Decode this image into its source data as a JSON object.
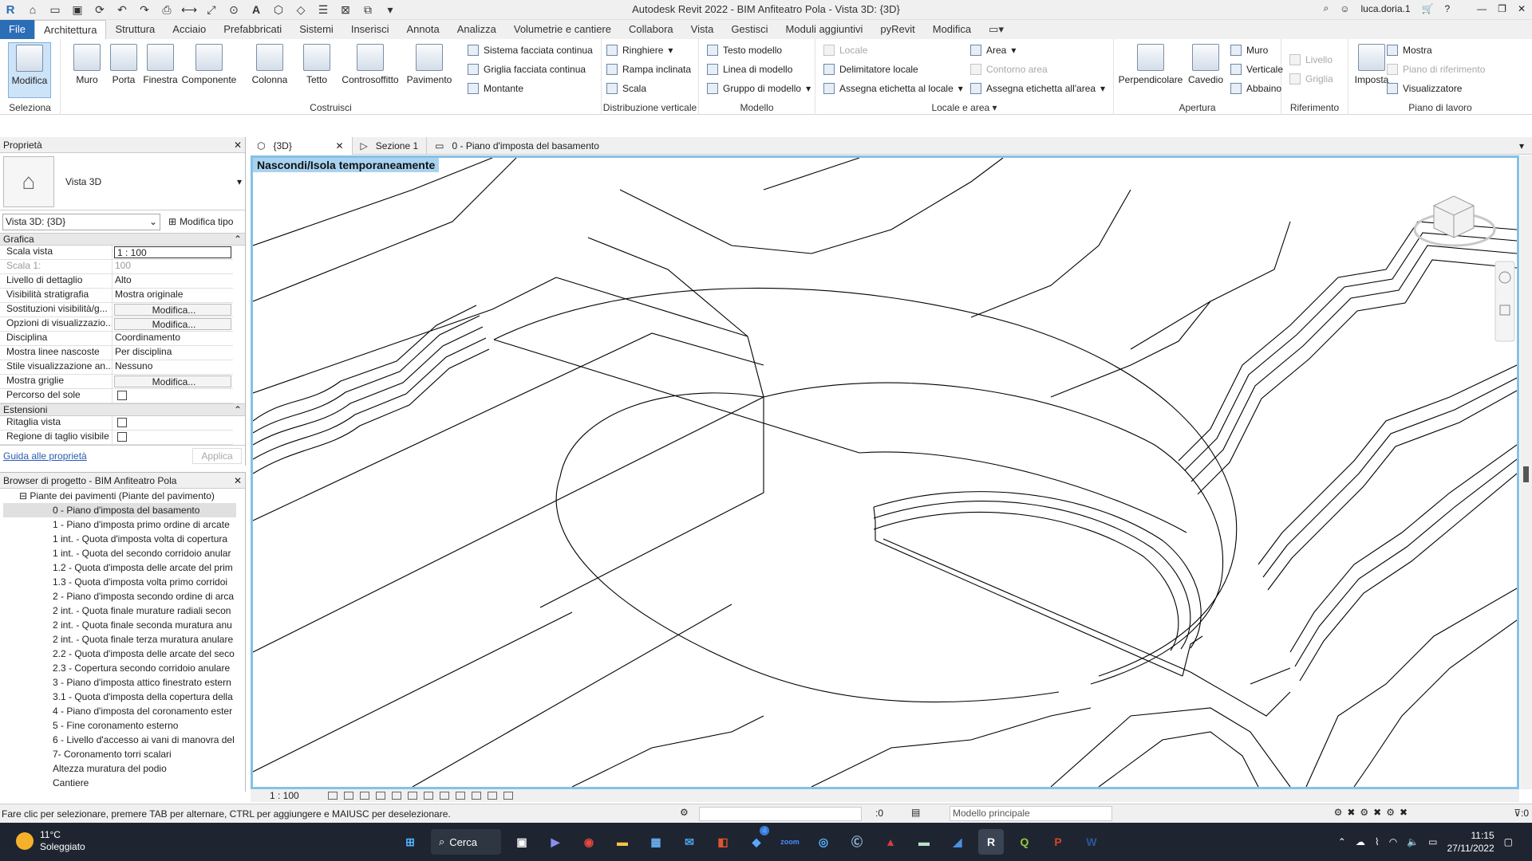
{
  "window": {
    "title": "Autodesk Revit 2022 - BIM Anfiteatro Pola - Vista 3D: {3D}",
    "user": "luca.doria.1"
  },
  "tabs": [
    "File",
    "Architettura",
    "Struttura",
    "Acciaio",
    "Prefabbricati",
    "Sistemi",
    "Inserisci",
    "Annota",
    "Analizza",
    "Volumetrie e cantiere",
    "Collabora",
    "Vista",
    "Gestisci",
    "Moduli aggiuntivi",
    "pyRevit",
    "Modifica"
  ],
  "ribbon": {
    "select": {
      "modify": "Modifica",
      "panel": "Seleziona"
    },
    "build": {
      "panel": "Costruisci",
      "items": [
        "Muro",
        "Porta",
        "Finestra",
        "Componente",
        "Colonna",
        "Tetto",
        "Controsoffitto",
        "Pavimento"
      ],
      "small": [
        "Sistema facciata continua",
        "Griglia facciata continua",
        "Montante"
      ]
    },
    "circulation": {
      "panel": "Distribuzione verticale",
      "items": [
        "Ringhiere",
        "Rampa inclinata",
        "Scala"
      ]
    },
    "model": {
      "panel": "Modello",
      "items": [
        "Testo modello",
        "Linea di modello",
        "Gruppo di modello"
      ]
    },
    "room": {
      "panel": "Locale e area",
      "left": [
        "Locale",
        "Delimitatore  locale",
        "Assegna etichetta  al locale"
      ],
      "right": [
        "Area",
        "Contorno  area",
        "Assegna etichetta  all'area"
      ]
    },
    "opening": {
      "panel": "Apertura",
      "big": [
        "Perpendicolare",
        "Cavedio"
      ],
      "small": [
        "Muro",
        "Verticale",
        "Abbaino"
      ]
    },
    "datum": {
      "panel": "Riferimento",
      "items": [
        "Livello",
        "Griglia"
      ]
    },
    "workplane": {
      "panel": "Piano di lavoro",
      "big": "Imposta",
      "items": [
        "Mostra",
        "Piano di riferimento",
        "Visualizzatore"
      ]
    }
  },
  "properties": {
    "title": "Proprietà",
    "type": "Vista 3D",
    "selector": "Vista 3D: {3D}",
    "edit_type": "Modifica tipo",
    "cat_graphics": "Grafica",
    "rows": [
      {
        "k": "Scala vista",
        "v": "1 : 100"
      },
      {
        "k": "Scala  1:",
        "v": "100"
      },
      {
        "k": "Livello di dettaglio",
        "v": "Alto"
      },
      {
        "k": "Visibilità stratigrafia",
        "v": "Mostra originale"
      },
      {
        "k": "Sostituzioni visibilità/g...",
        "v": "Modifica..."
      },
      {
        "k": "Opzioni di visualizzazio...",
        "v": "Modifica..."
      },
      {
        "k": "Disciplina",
        "v": "Coordinamento"
      },
      {
        "k": "Mostra linee nascoste",
        "v": "Per disciplina"
      },
      {
        "k": "Stile visualizzazione an...",
        "v": "Nessuno"
      },
      {
        "k": "Mostra griglie",
        "v": "Modifica..."
      },
      {
        "k": "Percorso del sole",
        "v": ""
      }
    ],
    "cat_extents": "Estensioni",
    "extents": [
      {
        "k": "Ritaglia vista",
        "v": ""
      },
      {
        "k": "Regione di taglio visibile",
        "v": ""
      }
    ],
    "help": "Guida alle proprietà",
    "apply": "Applica"
  },
  "browser": {
    "title": "Browser di progetto - BIM Anfiteatro Pola",
    "root": "Piante dei pavimenti (Piante del pavimento)",
    "items": [
      "0 - Piano d'imposta del basamento",
      "1 - Piano d'imposta primo ordine di arcate",
      "1 int. - Quota d'imposta volta di copertura",
      "1 int. - Quota del secondo corridoio anular",
      "1.2 - Quota d'imposta delle arcate del prim",
      "1.3 - Quota d'imposta volta primo corridoi",
      "2 - Piano d'imposta secondo ordine di arca",
      "2 int. - Quota finale murature radiali secon",
      "2 int. - Quota finale seconda muratura anu",
      "2 int. - Quota finale terza muratura anulare",
      "2.2 - Quota d'imposta delle arcate del seco",
      "2.3 - Copertura secondo corridoio anulare",
      "3 - Piano d'imposta attico finestrato estern",
      "3.1 - Quota d'imposta della copertura della",
      "4 - Piano d'imposta del coronamento ester",
      "5 - Fine coronamento esterno",
      "6 - Livello d'accesso ai vani di manovra del",
      "7- Coronamento torri scalari",
      "Altezza muratura del podio",
      "Cantiere"
    ]
  },
  "view_tabs": [
    "{3D}",
    "Sezione 1",
    "0 - Piano d'imposta del basamento"
  ],
  "canvas": {
    "banner": "Nascondi/Isola temporaneamente",
    "scale": "1 : 100"
  },
  "status": {
    "message": "Fare clic per selezionare, premere TAB per alternare, CTRL per aggiungere e MAIUSC per deselezionare.",
    "zero": ":0",
    "model": "Modello principale",
    "filter": ":0"
  },
  "taskbar": {
    "temp": "11°C",
    "weather": "Soleggiato",
    "search": "Cerca",
    "time": "11:15",
    "date": "27/11/2022",
    "badge": "4"
  }
}
